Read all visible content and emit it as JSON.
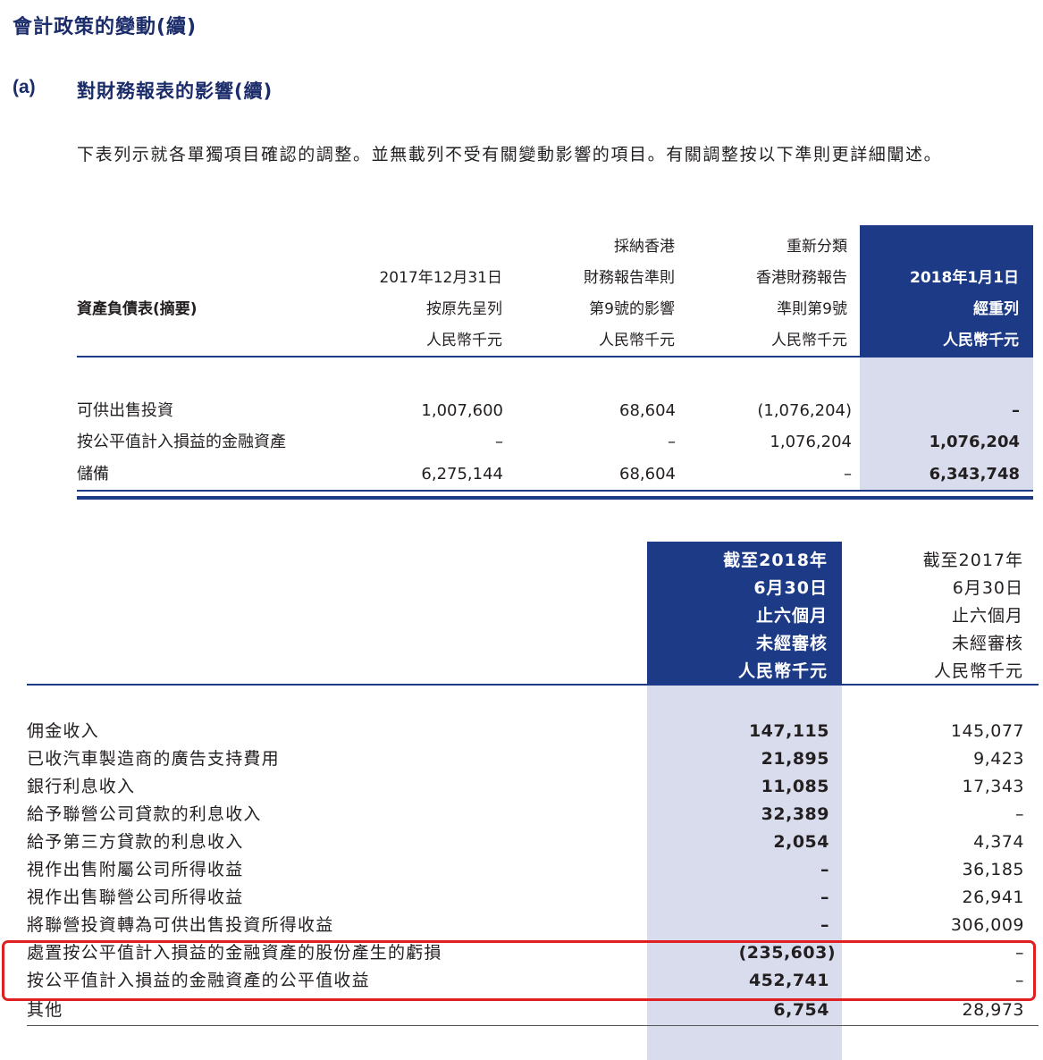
{
  "header": {
    "section_title": "會計政策的變動(續)",
    "sub_label": "(a)",
    "sub_title": "對財務報表的影響(續)",
    "intro": "下表列示就各單獨項目確認的調整。並無載列不受有關變動影響的項目。有關調整按以下準則更詳細闡述。"
  },
  "table1": {
    "row_header": "資產負債表(摘要)",
    "col1": [
      "2017年12月31日",
      "按原先呈列",
      "人民幣千元"
    ],
    "col2": [
      "採納香港",
      "財務報告準則",
      "第9號的影響",
      "人民幣千元"
    ],
    "col3": [
      "重新分類",
      "香港財務報告",
      "準則第9號",
      "人民幣千元"
    ],
    "col4": [
      "2018年1月1日",
      "經重列",
      "人民幣千元"
    ],
    "rows": [
      {
        "label": "可供出售投資",
        "v1": "1,007,600",
        "v2": "68,604",
        "v3": "(1,076,204)",
        "v4": "–"
      },
      {
        "label": "按公平值計入損益的金融資產",
        "v1": "–",
        "v2": "–",
        "v3": "1,076,204",
        "v4": "1,076,204"
      },
      {
        "label": "儲備",
        "v1": "6,275,144",
        "v2": "68,604",
        "v3": "–",
        "v4": "6,343,748"
      }
    ]
  },
  "table2": {
    "col2018": [
      "截至2018年",
      "6月30日",
      "止六個月",
      "未經審核",
      "人民幣千元"
    ],
    "col2017": [
      "截至2017年",
      "6月30日",
      "止六個月",
      "未經審核",
      "人民幣千元"
    ],
    "rows": [
      {
        "label": "佣金收入",
        "v18": "147,115",
        "v17": "145,077"
      },
      {
        "label": "已收汽車製造商的廣告支持費用",
        "v18": "21,895",
        "v17": "9,423"
      },
      {
        "label": "銀行利息收入",
        "v18": "11,085",
        "v17": "17,343"
      },
      {
        "label": "給予聯營公司貸款的利息收入",
        "v18": "32,389",
        "v17": "–"
      },
      {
        "label": "給予第三方貸款的利息收入",
        "v18": "2,054",
        "v17": "4,374"
      },
      {
        "label": "視作出售附屬公司所得收益",
        "v18": "–",
        "v17": "36,185"
      },
      {
        "label": "視作出售聯營公司所得收益",
        "v18": "–",
        "v17": "26,941"
      },
      {
        "label": "將聯營投資轉為可供出售投資所得收益",
        "v18": "–",
        "v17": "306,009"
      },
      {
        "label": "處置按公平值計入損益的金融資產的股份產生的虧損",
        "v18": "(235,603)",
        "v17": "–"
      },
      {
        "label": "按公平值計入損益的金融資產的公平值收益",
        "v18": "452,741",
        "v17": "–"
      },
      {
        "label": "其他",
        "v18": "6,754",
        "v17": "28,973"
      }
    ]
  },
  "colors": {
    "navy": "#1d3a86",
    "highlight_band": "#d9dcec",
    "annotation_red": "#e02020"
  }
}
